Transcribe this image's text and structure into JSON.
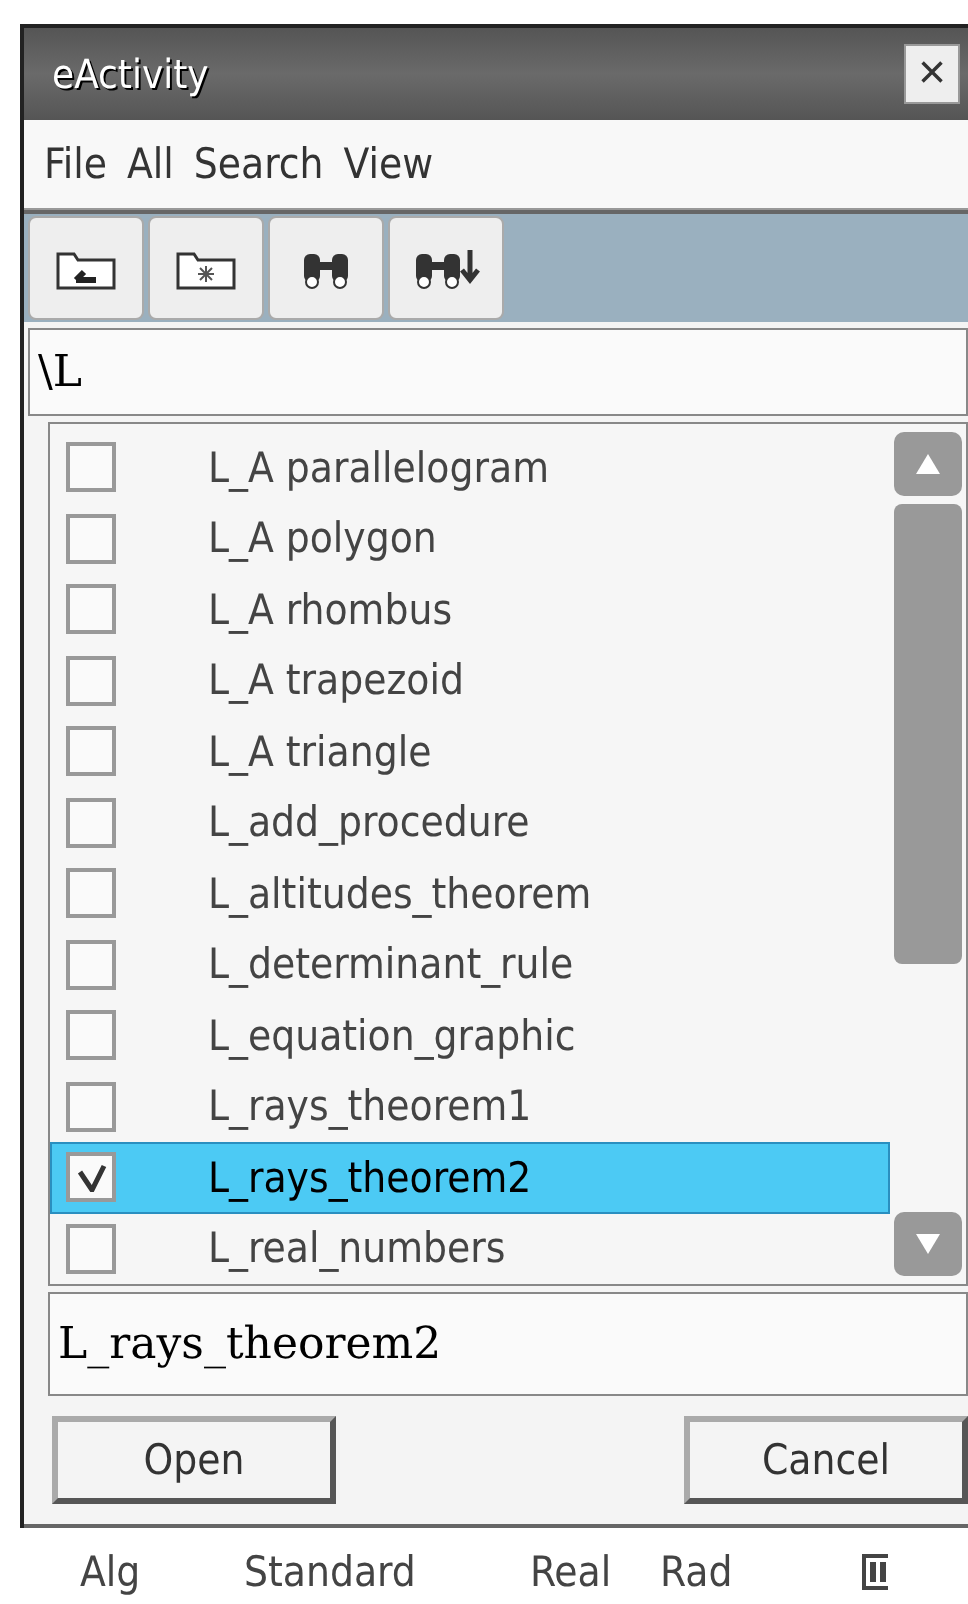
{
  "window": {
    "title": "eActivity",
    "close": "×"
  },
  "menu": [
    "File",
    "All",
    "Search",
    "View"
  ],
  "toolbar": [
    {
      "kind": "up-folder"
    },
    {
      "kind": "new-folder"
    },
    {
      "kind": "find"
    },
    {
      "kind": "find-next"
    }
  ],
  "path": "\\L",
  "files": [
    {
      "name": "L_A parallelogram",
      "checked": false,
      "selected": false
    },
    {
      "name": "L_A polygon",
      "checked": false,
      "selected": false
    },
    {
      "name": "L_A rhombus",
      "checked": false,
      "selected": false
    },
    {
      "name": "L_A trapezoid",
      "checked": false,
      "selected": false
    },
    {
      "name": "L_A triangle",
      "checked": false,
      "selected": false
    },
    {
      "name": "L_add_procedure",
      "checked": false,
      "selected": false
    },
    {
      "name": "L_altitudes_theorem",
      "checked": false,
      "selected": false
    },
    {
      "name": "L_determinant_rule",
      "checked": false,
      "selected": false
    },
    {
      "name": "L_equation_graphic",
      "checked": false,
      "selected": false
    },
    {
      "name": "L_rays_theorem1",
      "checked": false,
      "selected": false
    },
    {
      "name": "L_rays_theorem2",
      "checked": true,
      "selected": true
    },
    {
      "name": "L_real_numbers",
      "checked": false,
      "selected": false
    }
  ],
  "filename": "L_rays_theorem2",
  "buttons": [
    "Open",
    "Cancel"
  ],
  "status_bar": [
    "Alg",
    "Standard",
    "Real",
    "Rad"
  ]
}
